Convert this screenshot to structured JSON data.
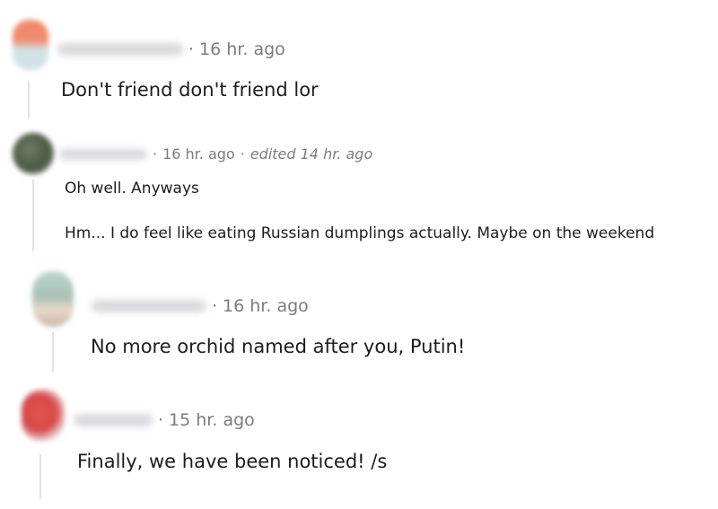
{
  "colors": {
    "text": "#1c1c1c",
    "meta": "#7c7c7c",
    "thread_line": "#e3e3e3"
  },
  "comments": [
    {
      "username": "",
      "separator": "·",
      "time": "16 hr. ago",
      "body": [
        "Don't friend don't friend lor"
      ],
      "avatar_icon": "user-avatar-icon"
    },
    {
      "username": "",
      "separator": "·",
      "time": "16 hr. ago",
      "edited_separator": "·",
      "edited": "edited 14 hr. ago",
      "body": [
        "Oh well. Anyways",
        "Hm... I do feel like eating Russian dumplings actually. Maybe on the weekend"
      ],
      "avatar_icon": "user-avatar-icon"
    },
    {
      "username": "",
      "separator": "·",
      "time": "16 hr. ago",
      "body": [
        "No more orchid named after you, Putin!"
      ],
      "avatar_icon": "user-avatar-icon"
    },
    {
      "username": "",
      "separator": "·",
      "time": "15 hr. ago",
      "body": [
        "Finally, we have been noticed! /s"
      ],
      "avatar_icon": "user-avatar-icon"
    }
  ]
}
